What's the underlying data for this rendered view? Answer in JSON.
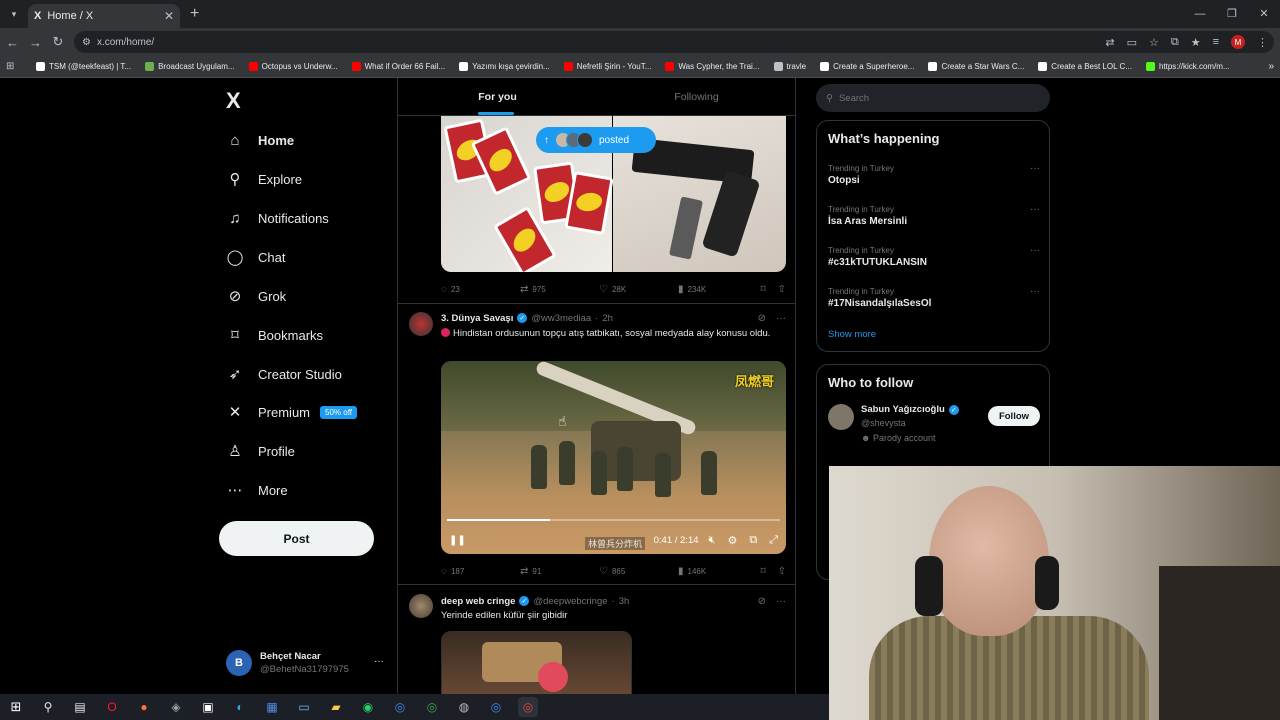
{
  "browser": {
    "tab_title": "Home / X",
    "tab_logo": "X",
    "url": "x.com/home/",
    "profile_initial": "M",
    "bookmarks": [
      {
        "label": "TSM (@teekfeast) | T...",
        "color": "#ffffff"
      },
      {
        "label": "Broadcast Uygulam...",
        "color": "#6ab04c"
      },
      {
        "label": "Octopus vs Underw...",
        "color": "#ff0000"
      },
      {
        "label": "What if Order 66 Fail...",
        "color": "#ff0000"
      },
      {
        "label": "Yazımı kışa çevirdin...",
        "color": "#ffffff"
      },
      {
        "label": "Nefretli Şirin - YouT...",
        "color": "#ff0000"
      },
      {
        "label": "Was Cypher, the Trai...",
        "color": "#ff0000"
      },
      {
        "label": "travle",
        "color": "#bdc1c6"
      },
      {
        "label": "Create a Superheroe...",
        "color": "#ffffff"
      },
      {
        "label": "Create a Star Wars C...",
        "color": "#ffffff"
      },
      {
        "label": "Create a Best LOL C...",
        "color": "#ffffff"
      },
      {
        "label": "https://kick.com/m...",
        "color": "#53fc18"
      }
    ]
  },
  "nav": {
    "logo": "X",
    "items": [
      {
        "label": "Home",
        "icon": "home-icon",
        "glyph": "⌂"
      },
      {
        "label": "Explore",
        "icon": "search-icon",
        "glyph": "⚲"
      },
      {
        "label": "Notifications",
        "icon": "bell-icon",
        "glyph": "♫"
      },
      {
        "label": "Chat",
        "icon": "chat-icon",
        "glyph": "◯"
      },
      {
        "label": "Grok",
        "icon": "grok-icon",
        "glyph": "⊘"
      },
      {
        "label": "Bookmarks",
        "icon": "bookmark-icon",
        "glyph": "⌑"
      },
      {
        "label": "Creator Studio",
        "icon": "rocket-icon",
        "glyph": "➶"
      },
      {
        "label": "Premium",
        "icon": "x-premium-icon",
        "glyph": "✕"
      },
      {
        "label": "Profile",
        "icon": "person-icon",
        "glyph": "♙"
      },
      {
        "label": "More",
        "icon": "more-circle-icon",
        "glyph": "⋯"
      }
    ],
    "premium_badge": "50% off",
    "post_button": "Post"
  },
  "account": {
    "initial": "B",
    "name": "Behçet Nacar",
    "handle": "@BehetNa31797975",
    "more": "···"
  },
  "feed": {
    "tabs": [
      "For you",
      "Following"
    ],
    "posted_pill": "posted",
    "post1": {
      "replies": "23",
      "reposts": "975",
      "likes": "28K",
      "views": "234K"
    },
    "post2": {
      "name": "3. Dünya Savaşı",
      "handle": "@ww3mediaa",
      "time": "2h",
      "text": "Hindistan ordusunun topçu atış tatbikatı, sosyal medyada alay konusu oldu.",
      "video_watermark": "凤燃哥",
      "video_caption": "林曾兵分炸机",
      "video_time": "0:41 / 2:14",
      "video_progress": 0.31,
      "replies": "187",
      "reposts": "91",
      "likes": "865",
      "views": "146K"
    },
    "post3": {
      "name": "deep web cringe",
      "handle": "@deepwebcringe",
      "time": "3h",
      "text": "Yerinde edilen küfür şiir gibidir"
    }
  },
  "sidebar": {
    "search_placeholder": "Search",
    "whats_happening": "What’s happening",
    "trends": [
      {
        "context": "Trending in Turkey",
        "name": "Otopsi"
      },
      {
        "context": "Trending in Turkey",
        "name": "İsa Aras Mersinli"
      },
      {
        "context": "Trending in Turkey",
        "name": "#c31kTUTUKLANSIN"
      },
      {
        "context": "Trending in Turkey",
        "name": "#17NisandalşılaSesOl"
      }
    ],
    "show_more": "Show more",
    "who_to_follow": "Who to follow",
    "suggestion": {
      "name": "Sabun Yağızcıoğlu",
      "handle": "@shevysta",
      "note": "Parody account",
      "follow": "Follow"
    }
  }
}
